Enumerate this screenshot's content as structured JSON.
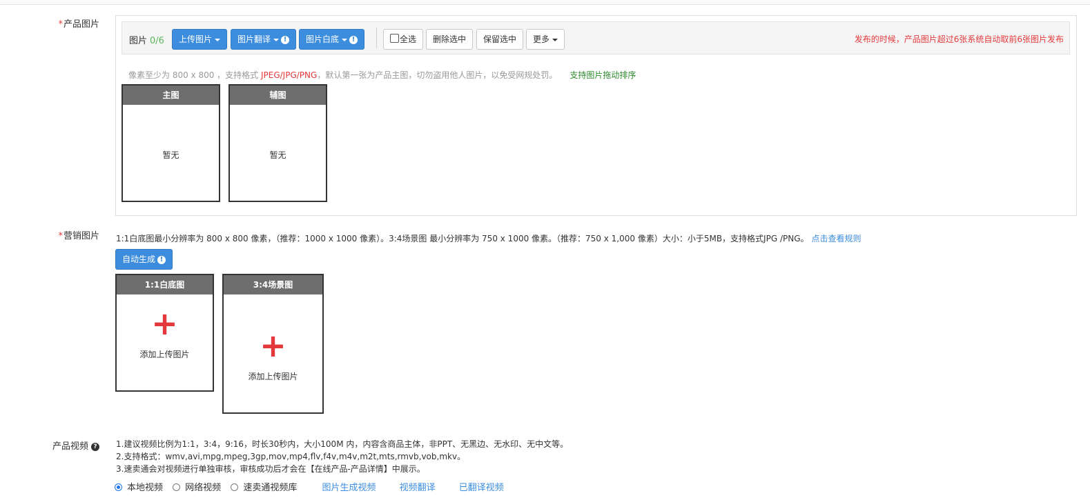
{
  "product_images": {
    "label": "产品图片",
    "toolbar": {
      "images_label": "图片",
      "count": "0/6",
      "upload_button": "上传图片",
      "translate_button": "图片翻译",
      "white_bg_button": "图片白底",
      "select_all": "全选",
      "delete_selected": "删除选中",
      "keep_selected": "保留选中",
      "more": "更多",
      "warning": "发布的时候，产品图片超过6张系统自动取前6张图片发布"
    },
    "hint": {
      "prefix": "像素至少为 800 x 800 ，支持格式 ",
      "formats": "JPEG/JPG/PNG",
      "suffix": "，默认第一张为产品主图，切勿盗用他人图片，以免受网规处罚。",
      "sort_tip": "支持图片拖动排序"
    },
    "slots": [
      {
        "title": "主图",
        "empty_text": "暂无"
      },
      {
        "title": "辅图",
        "empty_text": "暂无"
      }
    ]
  },
  "marketing_images": {
    "label": "营销图片",
    "description": "1:1白底图最小分辨率为 800 x 800 像素，（推荐：1000 x 1000 像素）。3:4场景图 最小分辨率为 750 x 1000 像素。（推荐：750 x 1,000 像素）大小：小于5MB，支持格式JPG /PNG。",
    "rules_link": "点击查看规则",
    "auto_generate_button": "自动生成",
    "slots": [
      {
        "title": "1:1白底图",
        "add_text": "添加上传图片"
      },
      {
        "title": "3:4场景图",
        "add_text": "添加上传图片"
      }
    ]
  },
  "product_video": {
    "label": "产品视频",
    "lines": [
      "1.建议视频比例为1:1，3:4，9:16，时长30秒内，大小100M 内，内容含商品主体，非PPT、无黑边、无水印、无中文等。",
      "2.支持格式：wmv,avi,mpg,mpeg,3gp,mov,mp4,flv,f4v,m4v,m2t,mts,rmvb,vob,mkv。",
      "3.速卖通会对视频进行单独审核，审核成功后才会在【在线产品-产品详情】中展示。"
    ],
    "source_options": [
      {
        "label": "本地视频",
        "selected": true
      },
      {
        "label": "网络视频",
        "selected": false
      },
      {
        "label": "速卖通视频库",
        "selected": false
      }
    ],
    "links": [
      "图片生成视频",
      "视频翻译",
      "已翻译视频"
    ]
  },
  "colors": {
    "accent": "#3c8dde",
    "warning": "#e4393c",
    "success": "#5cb85c"
  }
}
